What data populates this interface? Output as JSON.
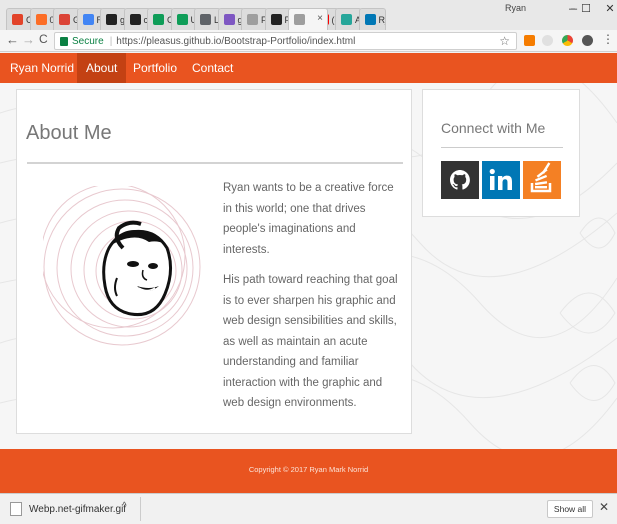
{
  "browser": {
    "tabs": [
      {
        "label": "Cl",
        "icon": "gitlab-icon",
        "color": "#e24329"
      },
      {
        "label": "03",
        "icon": "gitlab-icon",
        "color": "#fc6d26"
      },
      {
        "label": "Gi",
        "icon": "calendar-icon",
        "color": "#db4437"
      },
      {
        "label": "Ry",
        "icon": "docs-icon",
        "color": "#4285f4"
      },
      {
        "label": "gi",
        "icon": "github-icon",
        "color": "#222222"
      },
      {
        "label": "cc",
        "icon": "github-icon",
        "color": "#222222"
      },
      {
        "label": "Ca",
        "icon": "sheet-icon",
        "color": "#0f9d58"
      },
      {
        "label": "Uj",
        "icon": "sheet-icon",
        "color": "#0f9d58"
      },
      {
        "label": "Le",
        "icon": "page-icon",
        "color": "#5f6368"
      },
      {
        "label": "ge",
        "icon": "app-icon",
        "color": "#7e57c2"
      },
      {
        "label": "Fr",
        "icon": "page-icon",
        "color": "#9e9e9e"
      },
      {
        "label": "Pl",
        "icon": "github-icon",
        "color": "#222222"
      },
      {
        "label": "",
        "icon": "page-icon",
        "color": "#9e9e9e"
      },
      {
        "label": "(8",
        "icon": "youtube-icon",
        "color": "#ff0000"
      },
      {
        "label": "Al",
        "icon": "app-icon",
        "color": "#26a69a"
      },
      {
        "label": "Rj",
        "icon": "linkedin-icon",
        "color": "#0077b5"
      }
    ],
    "tab_close": "×",
    "profile": "Ryan",
    "minimize": "–",
    "maximize": "☐",
    "close": "✕",
    "back": "←",
    "forward": "→",
    "reload": "C",
    "secure_label": "Secure",
    "url": "https://pleasus.github.io/Bootstrap-Portfolio/index.html",
    "bookmark": "☆"
  },
  "site": {
    "brand": "Ryan Norrid",
    "nav": [
      "About",
      "Portfolio",
      "Contact"
    ],
    "about": {
      "title": "About Me",
      "paragraphs": [
        "Ryan wants to be a creative force in this world; one that drives people's imaginations and interests.",
        "His path toward reaching that goal is to ever sharpen his graphic and web design sensibilities and skills, as well as maintain an acute understanding and familiar interaction with the graphic and web design environments."
      ]
    },
    "connect": {
      "title": "Connect with Me",
      "github_color": "#333333",
      "linkedin_color": "#0077b5",
      "stackoverflow_color": "#f48024"
    },
    "footer": "Copyright © 2017 Ryan Mark Norrid",
    "accent_color": "#e95420"
  },
  "downloads": {
    "file": "Webp.net-gifmaker.gif",
    "caret": "^",
    "show_all": "Show all",
    "close": "✕"
  }
}
